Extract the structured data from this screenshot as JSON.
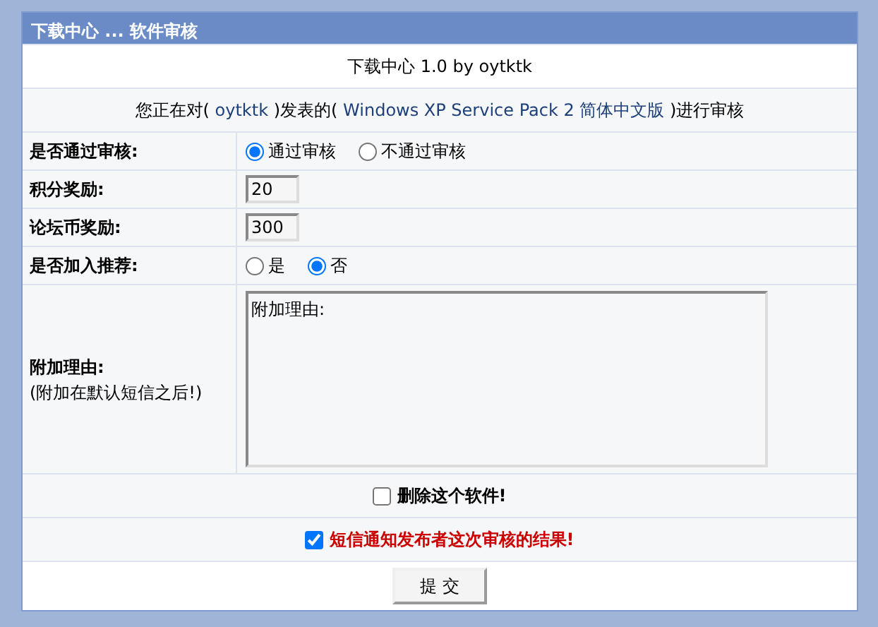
{
  "header": {
    "title": "下载中心 ... 软件审核"
  },
  "subtitle": "下载中心 1.0 by oytktk",
  "review_notice": {
    "prefix": "您正在对(",
    "user_link": "oytktk",
    "middle": ")发表的(",
    "software_link": "Windows XP Service Pack 2 简体中文版",
    "suffix": ")进行审核"
  },
  "fields": [
    {
      "kind": "radio",
      "label": "是否通过审核:",
      "options": [
        {
          "label": "通过审核",
          "selected": true
        },
        {
          "label": "不通过审核",
          "selected": false
        }
      ]
    },
    {
      "kind": "text",
      "label": "积分奖励:",
      "value": "20"
    },
    {
      "kind": "text",
      "label": "论坛币奖励:",
      "value": "300"
    },
    {
      "kind": "radio",
      "label": "是否加入推荐:",
      "options": [
        {
          "label": "是",
          "selected": false
        },
        {
          "label": "否",
          "selected": true
        }
      ]
    },
    {
      "kind": "textarea",
      "label": "附加理由:",
      "note": "(附加在默认短信之后!)",
      "value": "附加理由:"
    }
  ],
  "checkboxes": [
    {
      "label": "删除这个软件!",
      "checked": false,
      "color": "#000000"
    },
    {
      "label": "短信通知发布者这次审核的结果!",
      "checked": true,
      "color": "#cc0000"
    }
  ],
  "submit": "提 交"
}
